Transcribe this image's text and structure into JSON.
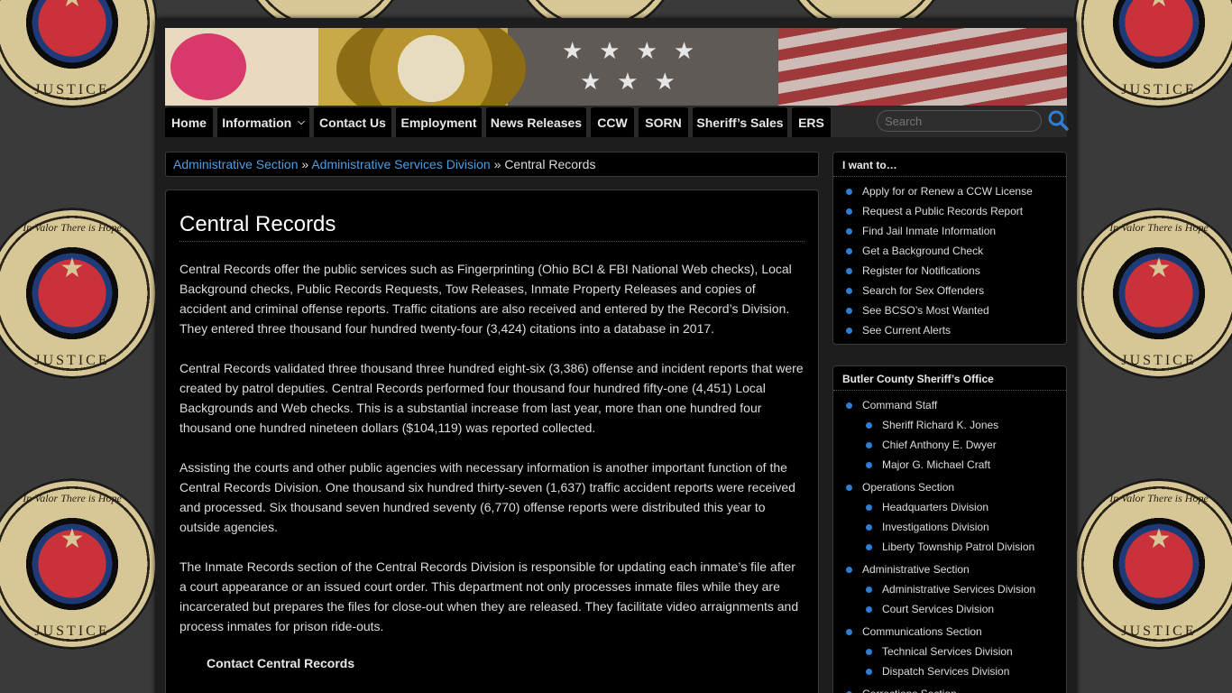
{
  "nav": {
    "items": [
      {
        "label": "Home"
      },
      {
        "label": "Information"
      },
      {
        "label": "Contact Us"
      },
      {
        "label": "Employment"
      },
      {
        "label": "News Releases"
      },
      {
        "label": "CCW"
      },
      {
        "label": "SORN"
      },
      {
        "label": "Sheriff’s Sales"
      },
      {
        "label": "ERS"
      }
    ],
    "search_placeholder": "Search"
  },
  "badge": {
    "motto": "In Valor There is Hope",
    "bottom": "JUSTICE"
  },
  "breadcrumb": {
    "link1": "Administrative Section",
    "link2": "Administrative Services Division",
    "sep": "»",
    "current": "Central Records"
  },
  "content": {
    "title": "Central Records",
    "p1": "Central Records offer the public services such as Fingerprinting (Ohio BCI & FBI National Web checks), Local Background checks, Public Records Requests, Tow Releases, Inmate Property Releases and copies of accident and criminal offense reports. Traffic citations are also received and entered by the Record’s Division. They entered three thousand four hundred twenty-four (3,424) citations into a database in 2017.",
    "p2": "Central Records validated three thousand three hundred eight-six (3,386) offense and incident reports that were created by patrol deputies. Central Records performed four thousand four hundred fifty-one (4,451) Local Backgrounds and Web checks. This is a substantial increase from last year, more than one hundred four thousand one hundred nineteen dollars ($104,119) was reported collected.",
    "p3": "Assisting the courts and other public agencies with necessary information is another important function of the Central Records Division. One thousand six hundred thirty-seven (1,637) traffic accident reports were received and processed. Six thousand seven hundred seventy (6,770) offense reports were distributed this year to outside agencies.",
    "p4": "The Inmate Records section of the Central Records Division is responsible for updating each inmate’s file after a court appearance or an issued court order. This department not only processes inmate files while they are incarcerated but prepares the files for close-out when they are released. They facilitate video arraignments and process inmates for prison ride-outs.",
    "contact_heading": "Contact Central Records"
  },
  "sidebar_want": {
    "title": "I want to…",
    "items": [
      "Apply for or Renew a CCW License",
      "Request a Public Records Report",
      "Find Jail Inmate Information",
      "Get a Background Check",
      "Register for Notifications",
      "Search for Sex Offenders",
      "See BCSO’s Most Wanted",
      "See Current Alerts"
    ]
  },
  "sidebar_office": {
    "title": "Butler County Sheriff’s Office",
    "command": "Command Staff",
    "command_items": [
      "Sheriff Richard K. Jones",
      "Chief Anthony E. Dwyer",
      "Major G. Michael Craft"
    ],
    "operations": "Operations Section",
    "operations_items": [
      "Headquarters Division",
      "Investigations Division",
      "Liberty Township Patrol Division"
    ],
    "administrative": "Administrative Section",
    "administrative_items": [
      "Administrative Services Division",
      "Court Services Division"
    ],
    "communications": "Communications Section",
    "communications_items": [
      "Technical Services Division",
      "Dispatch Services Division"
    ],
    "corrections": "Corrections Section"
  },
  "colors": {
    "link": "#4a9fe6",
    "bullet": "#2d7fd6",
    "panel": "#000000"
  }
}
